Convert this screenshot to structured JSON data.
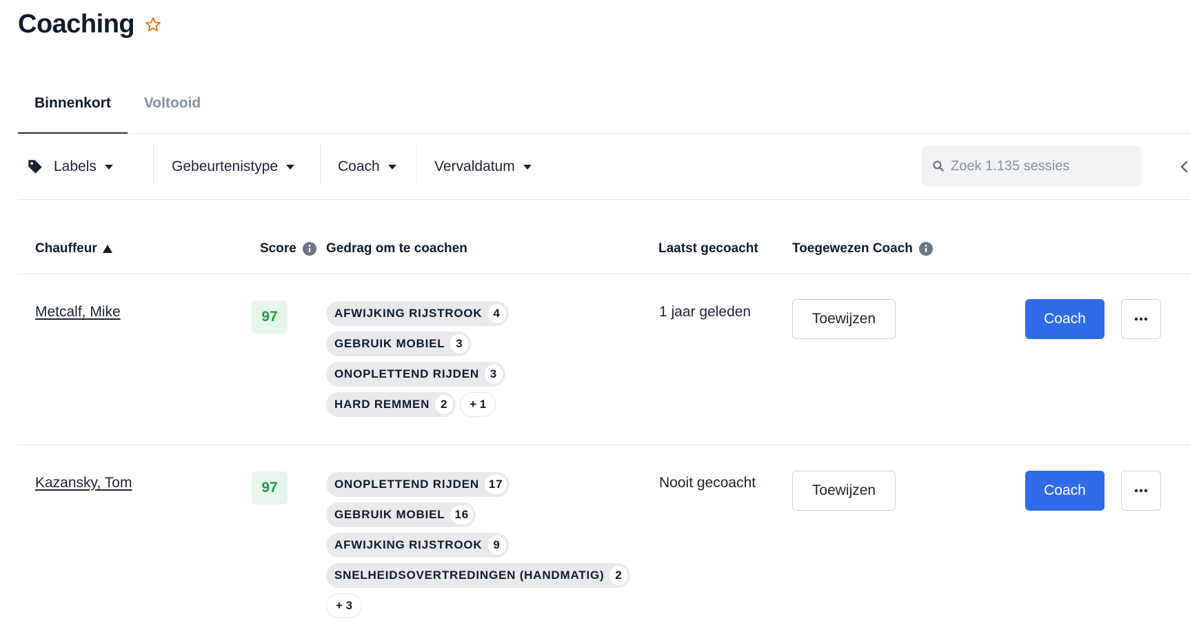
{
  "page": {
    "title": "Coaching",
    "favorite_icon": "star-outline-icon",
    "accent_color": "#e8701a"
  },
  "tabs": [
    {
      "label": "Binnenkort",
      "active": true
    },
    {
      "label": "Voltooid",
      "active": false
    }
  ],
  "filters": {
    "labels": "Labels",
    "event_type": "Gebeurtenistype",
    "coach": "Coach",
    "due_date": "Vervaldatum"
  },
  "search": {
    "placeholder": "Zoek 1.135 sessies",
    "value": ""
  },
  "table": {
    "headers": {
      "driver": "Chauffeur",
      "score": "Score",
      "behavior": "Gedrag om te coachen",
      "last_coached": "Laatst gecoacht",
      "assigned_coach": "Toegewezen Coach"
    },
    "sort": {
      "column": "driver",
      "direction": "ascending"
    },
    "rows": [
      {
        "driver": "Metcalf, Mike",
        "score": "97",
        "behaviors": [
          {
            "label": "AFWIJKING RIJSTROOK",
            "count": "4"
          },
          {
            "label": "GEBRUIK MOBIEL",
            "count": "3"
          },
          {
            "label": "ONOPLETTEND RIJDEN",
            "count": "3"
          },
          {
            "label": "HARD REMMEN",
            "count": "2"
          }
        ],
        "more": "+ 1",
        "last_coached": "1 jaar geleden",
        "assign_label": "Toewijzen",
        "coach_label": "Coach"
      },
      {
        "driver": "Kazansky, Tom",
        "score": "97",
        "behaviors": [
          {
            "label": "ONOPLETTEND RIJDEN",
            "count": "17"
          },
          {
            "label": "GEBRUIK MOBIEL",
            "count": "16"
          },
          {
            "label": "AFWIJKING RIJSTROOK",
            "count": "9"
          },
          {
            "label": "SNELHEIDSOVERTREDINGEN (HANDMATIG)",
            "count": "2"
          }
        ],
        "more": "+ 3",
        "last_coached": "Nooit gecoacht",
        "assign_label": "Toewijzen",
        "coach_label": "Coach"
      }
    ]
  },
  "colors": {
    "primary_button": "#2e6be6",
    "score_good_bg": "#e6f6ea",
    "score_good_text": "#1f9d49"
  }
}
